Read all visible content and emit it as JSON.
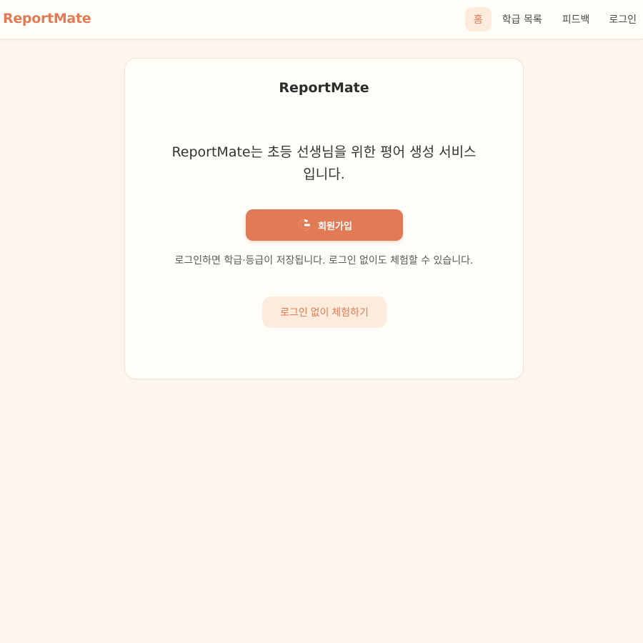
{
  "header": {
    "brand": "ReportMate",
    "nav": [
      {
        "label": "홈",
        "active": true
      },
      {
        "label": "학급 목록",
        "active": false
      },
      {
        "label": "피드백",
        "active": false
      },
      {
        "label": "로그인",
        "active": false
      }
    ]
  },
  "card": {
    "title": "ReportMate",
    "description": "ReportMate는 초등 선생님을 위한 평어 생성 서비스입니다.",
    "signup_button": {
      "label": "회원가입",
      "icon": "google-icon"
    },
    "helper_text": "로그인하면 학급·등급이 저장됩니다. 로그인 없이도 체험할 수 있습니다.",
    "trial_button": {
      "label": "로그인 없이 체험하기"
    }
  },
  "colors": {
    "accent": "#e07b55",
    "accent_soft": "#fdebdc",
    "background": "#fdf6ee",
    "surface": "#fffdf8"
  }
}
